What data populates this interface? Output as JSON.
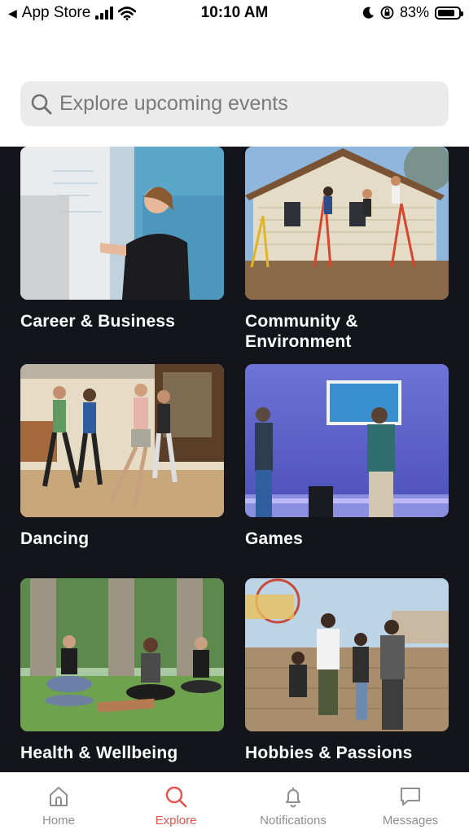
{
  "status_bar": {
    "back_app": "App Store",
    "time": "10:10 AM",
    "battery": "83%",
    "battery_level": 0.83
  },
  "search": {
    "placeholder": "Explore upcoming events",
    "icon": "search-icon"
  },
  "categories": [
    {
      "label": "Career & Business"
    },
    {
      "label": "Community & Environment"
    },
    {
      "label": "Dancing"
    },
    {
      "label": "Games"
    },
    {
      "label": "Health & Wellbeing"
    },
    {
      "label": "Hobbies & Passions"
    }
  ],
  "tabs": [
    {
      "label": "Home",
      "icon": "home-icon"
    },
    {
      "label": "Explore",
      "icon": "search-icon",
      "active": true
    },
    {
      "label": "Notifications",
      "icon": "bell-icon"
    },
    {
      "label": "Messages",
      "icon": "message-icon"
    }
  ],
  "colors": {
    "accent": "#e4524b",
    "background": "#14151a",
    "inactive": "#8e8e8e"
  }
}
